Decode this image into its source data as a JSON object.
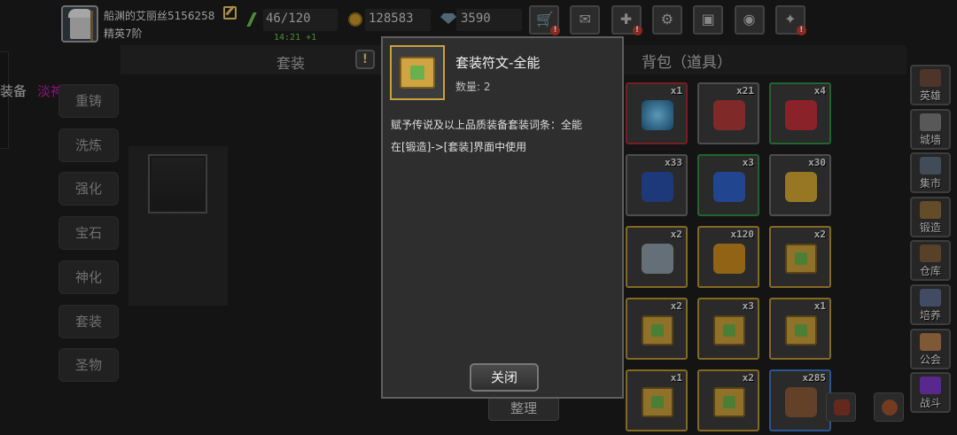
{
  "player": {
    "name": "船渊的艾丽丝5156258",
    "rank": "精英7阶"
  },
  "resources": {
    "energy": "46/120",
    "energy_timer": "14:21 +1",
    "gold": "128583",
    "gems": "3590"
  },
  "toolbar": [
    {
      "icon": "shop-cart-icon",
      "alert": true
    },
    {
      "icon": "mail-icon",
      "alert": false
    },
    {
      "icon": "gamepad-icon",
      "alert": true
    },
    {
      "icon": "gear-icon",
      "alert": false
    },
    {
      "icon": "gift-icon",
      "alert": false
    },
    {
      "icon": "color-wheel-icon",
      "alert": false
    },
    {
      "icon": "magic-wand-icon",
      "alert": true
    }
  ],
  "left_panel": {
    "equip_label": "装备",
    "character_title": "淡神战靴",
    "menu": [
      "重铸",
      "洗炼",
      "强化",
      "宝石",
      "神化",
      "套装",
      "圣物"
    ]
  },
  "middle_panel": {
    "title": "套装",
    "info_glyph": "!"
  },
  "bag": {
    "title": "背包（道具）",
    "items": [
      {
        "name": "blue-orb-icon",
        "count": "x1",
        "border": "#a52a2a"
      },
      {
        "name": "red-gem-icon",
        "count": "x21",
        "border": "#6b6b6b"
      },
      {
        "name": "red-crystal-icon",
        "count": "x4",
        "border": "#2e8b3e"
      },
      {
        "name": "blue-gem-icon",
        "count": "x33",
        "border": "#6b6b6b"
      },
      {
        "name": "blue-crystal-icon",
        "count": "x3",
        "border": "#2e8b3e"
      },
      {
        "name": "gold-gem-icon",
        "count": "x30",
        "border": "#6b6b6b"
      },
      {
        "name": "feather-icon",
        "count": "x2",
        "border": "#b8922e"
      },
      {
        "name": "gold-shard-icon",
        "count": "x120",
        "border": "#b8922e"
      },
      {
        "name": "rune-scroll-icon",
        "count": "x2",
        "border": "#b8922e"
      },
      {
        "name": "rune-scroll-icon",
        "count": "x2",
        "border": "#b8922e"
      },
      {
        "name": "rune-scroll-icon",
        "count": "x3",
        "border": "#b8922e"
      },
      {
        "name": "rune-scroll-icon",
        "count": "x1",
        "border": "#b8922e"
      },
      {
        "name": "rune-scroll-icon",
        "count": "x1",
        "border": "#b8922e"
      },
      {
        "name": "rune-scroll-icon",
        "count": "x2",
        "border": "#b8922e"
      },
      {
        "name": "pouch-icon",
        "count": "x285",
        "border": "#3a78c8"
      }
    ],
    "sort_label": "整理"
  },
  "right_nav": [
    {
      "label": "英雄",
      "icon": "hero-icon"
    },
    {
      "label": "城墙",
      "icon": "wall-icon"
    },
    {
      "label": "集市",
      "icon": "market-icon"
    },
    {
      "label": "锻造",
      "icon": "anvil-icon"
    },
    {
      "label": "仓库",
      "icon": "warehouse-icon"
    },
    {
      "label": "培养",
      "icon": "train-icon"
    },
    {
      "label": "公会",
      "icon": "guild-icon"
    },
    {
      "label": "战斗",
      "icon": "portal-icon"
    }
  ],
  "dialog": {
    "item_name": "套装符文-全能",
    "quantity": "数量: 2",
    "desc_line1": "赋予传说及以上品质装备套装词条：全能",
    "desc_line2": "在[锻造]->[套装]界面中使用",
    "close_label": "关闭"
  },
  "colors": {
    "accent_purple": "#c01fa6",
    "energy_green": "#69c24a",
    "gold_border": "#c9a23c"
  }
}
